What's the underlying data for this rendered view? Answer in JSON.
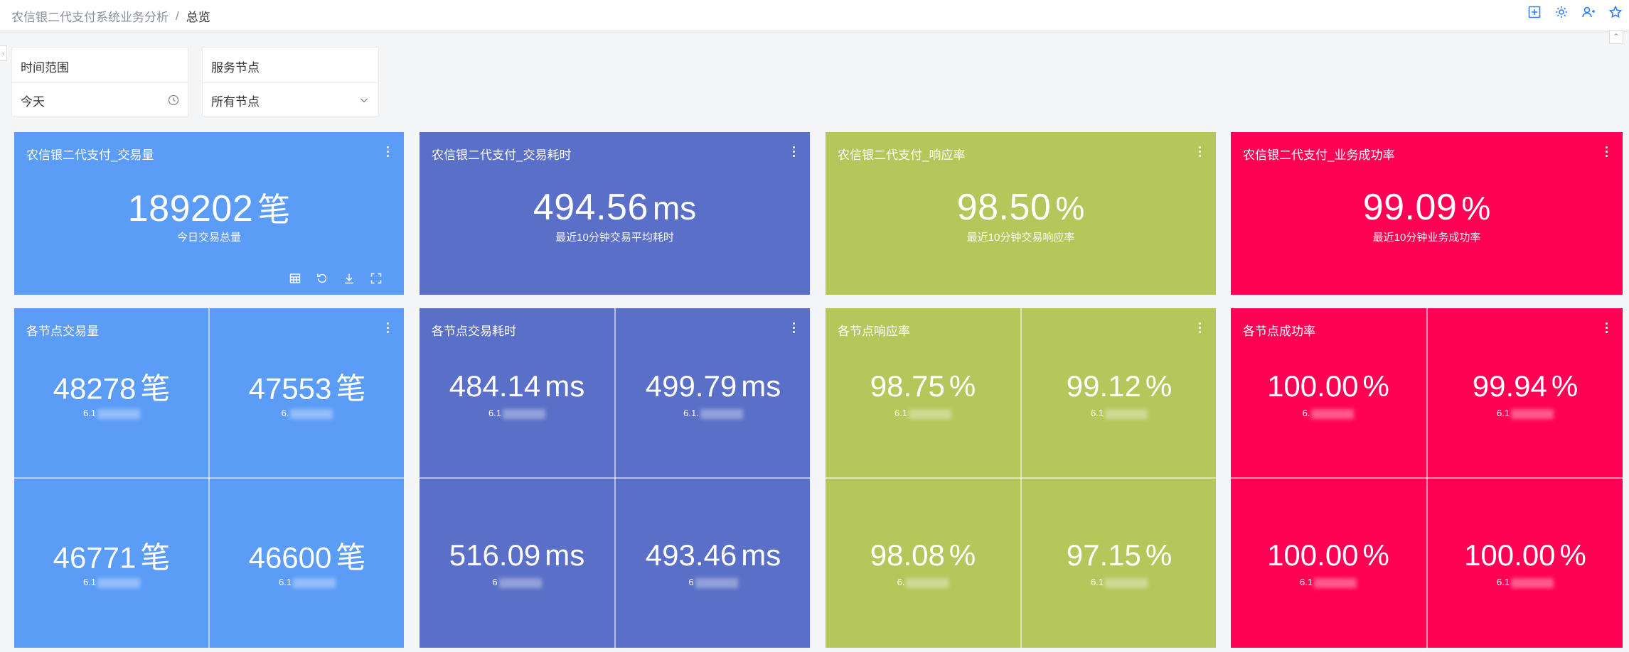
{
  "breadcrumb": {
    "parent": "农信银二代支付系统业务分析",
    "separator": "/",
    "current": "总览"
  },
  "top_actions": [
    {
      "icon": "add-panel-icon"
    },
    {
      "icon": "settings-gear-icon"
    },
    {
      "icon": "user-share-icon"
    },
    {
      "icon": "star-icon"
    }
  ],
  "filters": {
    "time_range": {
      "label": "时间范围",
      "value": "今天",
      "icon": "clock-icon"
    },
    "service_node": {
      "label": "服务节点",
      "value": "所有节点",
      "icon": "chevron-down-icon"
    }
  },
  "colors": {
    "blue": "#5b9cf7",
    "indigo": "#5a6fc7",
    "green": "#b5c75a",
    "red": "#ff0054"
  },
  "summary": [
    {
      "title": "农信银二代支付_交易量",
      "value": "189202",
      "unit": "笔",
      "subtitle": "今日交易总量"
    },
    {
      "title": "农信银二代支付_交易耗时",
      "value": "494.56",
      "unit": "ms",
      "subtitle": "最近10分钟交易平均耗时"
    },
    {
      "title": "农信银二代支付_响应率",
      "value": "98.50",
      "unit": "%",
      "subtitle": "最近10分钟交易响应率"
    },
    {
      "title": "农信银二代支付_业务成功率",
      "value": "99.09",
      "unit": "%",
      "subtitle": "最近10分钟业务成功率"
    }
  ],
  "nodes": [
    {
      "title": "各节点交易量",
      "cells": [
        {
          "value": "48278",
          "unit": "笔",
          "label": "6.1"
        },
        {
          "value": "47553",
          "unit": "笔",
          "label": "6."
        },
        {
          "value": "46771",
          "unit": "笔",
          "label": "6.1"
        },
        {
          "value": "46600",
          "unit": "笔",
          "label": "6.1"
        }
      ]
    },
    {
      "title": "各节点交易耗时",
      "cells": [
        {
          "value": "484.14",
          "unit": "ms",
          "label": "6.1"
        },
        {
          "value": "499.79",
          "unit": "ms",
          "label": "6.1."
        },
        {
          "value": "516.09",
          "unit": "ms",
          "label": "6"
        },
        {
          "value": "493.46",
          "unit": "ms",
          "label": "6"
        }
      ]
    },
    {
      "title": "各节点响应率",
      "cells": [
        {
          "value": "98.75",
          "unit": "%",
          "label": "6.1"
        },
        {
          "value": "99.12",
          "unit": "%",
          "label": "6.1"
        },
        {
          "value": "98.08",
          "unit": "%",
          "label": "6."
        },
        {
          "value": "97.15",
          "unit": "%",
          "label": "6.1"
        }
      ]
    },
    {
      "title": "各节点成功率",
      "cells": [
        {
          "value": "100.00",
          "unit": "%",
          "label": "6."
        },
        {
          "value": "99.94",
          "unit": "%",
          "label": "6.1"
        },
        {
          "value": "100.00",
          "unit": "%",
          "label": "6.1"
        },
        {
          "value": "100.00",
          "unit": "%",
          "label": "6.1"
        }
      ]
    }
  ]
}
